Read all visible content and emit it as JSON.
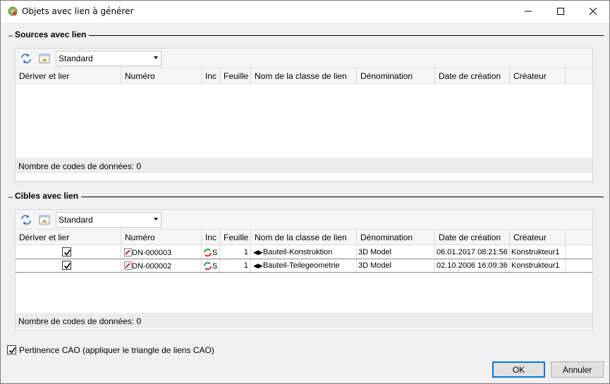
{
  "window": {
    "title": "Objets avec lien à générer",
    "minimize_glyph": "—",
    "maximize_glyph": "☐",
    "close_glyph": "✕"
  },
  "sources": {
    "group_title": "Sources avec lien",
    "collapse_glyph": "–",
    "view_select": "Standard",
    "columns": [
      "Dériver et lier",
      "Numéro",
      "Inc",
      "Feuille",
      "Nom de la classe de lien",
      "Dénomination",
      "Date de création",
      "Créateur"
    ],
    "footer": "Nombre de codes de données: 0"
  },
  "targets": {
    "group_title": "Cibles avec lien",
    "collapse_glyph": "–",
    "view_select": "Standard",
    "columns": [
      "Dériver et lier",
      "Numéro",
      "Inc",
      "Feuille",
      "Nom de la classe de lien",
      "Dénomination",
      "Date de création",
      "Créateur"
    ],
    "rows": [
      {
        "checked": true,
        "number": "DN-000003",
        "inc": "S",
        "sheet": "1",
        "link_class": "Bauteil-Konstruktion",
        "designation": "3D Model",
        "created": "06.01.2017 08:21:56",
        "creator": "Konstrukteur1"
      },
      {
        "checked": true,
        "number": "DN-000002",
        "inc": "S",
        "sheet": "1",
        "link_class": "Bauteil-Teilegeometrie",
        "designation": "3D Model",
        "created": "02.10.2006 16:09:36",
        "creator": "Konstrukteur1"
      }
    ],
    "footer": "Nombre de codes de données: 0"
  },
  "cad_relevance": {
    "checked": true,
    "label": "Pertinence CAO (appliquer le triangle de liens CAO)"
  },
  "buttons": {
    "ok": "OK",
    "cancel": "Annuler"
  }
}
